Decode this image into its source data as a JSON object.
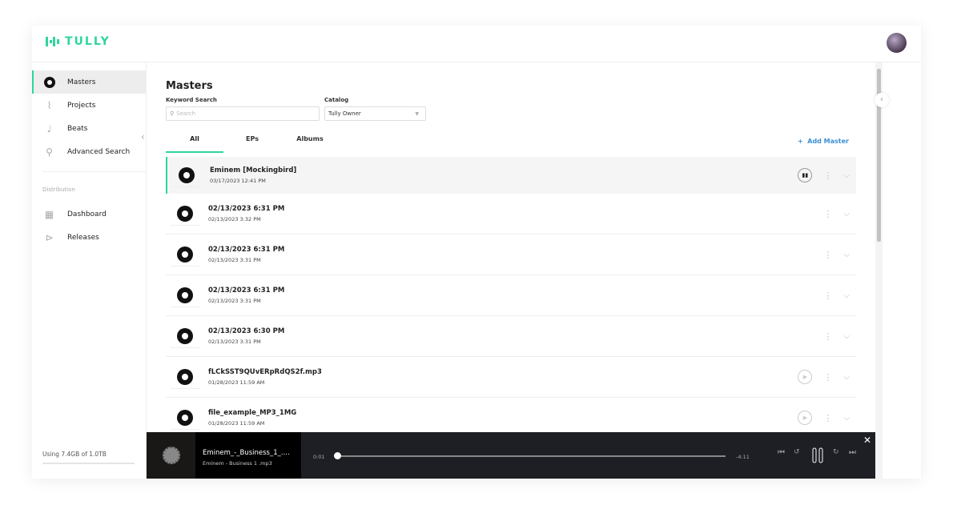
{
  "app": {
    "name": "TULLY",
    "accent": "#2fd69b",
    "link_color": "#3a8fd6"
  },
  "sidebar": {
    "items": [
      {
        "label": "Masters",
        "icon": "disc-icon",
        "active": true
      },
      {
        "label": "Projects",
        "icon": "waveform-icon"
      },
      {
        "label": "Beats",
        "icon": "music-note-icon"
      },
      {
        "label": "Advanced Search",
        "icon": "search-icon"
      }
    ],
    "section": "Distribution",
    "dist_items": [
      {
        "label": "Dashboard",
        "icon": "dashboard-icon"
      },
      {
        "label": "Releases",
        "icon": "releases-icon"
      }
    ],
    "storage": "Using 7.4GB of  1.0TB",
    "storage_fraction": 0.007
  },
  "main": {
    "title": "Masters",
    "keyword_label": "Keyword Search",
    "search_placeholder": "Search",
    "catalog_label": "Catalog",
    "catalog_value": "Tully Owner",
    "tabs": [
      "All",
      "EPs",
      "Albums"
    ],
    "active_tab": "All",
    "add_label": "Add Master",
    "rows": [
      {
        "title": "Eminem [Mockingbird]",
        "date": "03/17/2023 12:41 PM",
        "play": "playing"
      },
      {
        "title": "02/13/2023 6:31 PM",
        "date": "02/13/2023 3:32 PM",
        "play": "none"
      },
      {
        "title": "02/13/2023 6:31 PM",
        "date": "02/13/2023 3:31 PM",
        "play": "none"
      },
      {
        "title": "02/13/2023 6:31 PM",
        "date": "02/13/2023 3:31 PM",
        "play": "none"
      },
      {
        "title": "02/13/2023 6:30 PM",
        "date": "02/13/2023 3:31 PM",
        "play": "none"
      },
      {
        "title": "fLCkSST9QUvERpRdQS2f.mp3",
        "date": "01/28/2023 11:59 AM",
        "play": "play"
      },
      {
        "title": "file_example_MP3_1MG",
        "date": "01/28/2023 11:59 AM",
        "play": "play"
      }
    ]
  },
  "player": {
    "title": "Eminem_-_Business_1_....",
    "subtitle": "Eminem - Business  1 .mp3",
    "elapsed": "0:01",
    "remaining": "-4:11",
    "progress": 0.004
  }
}
